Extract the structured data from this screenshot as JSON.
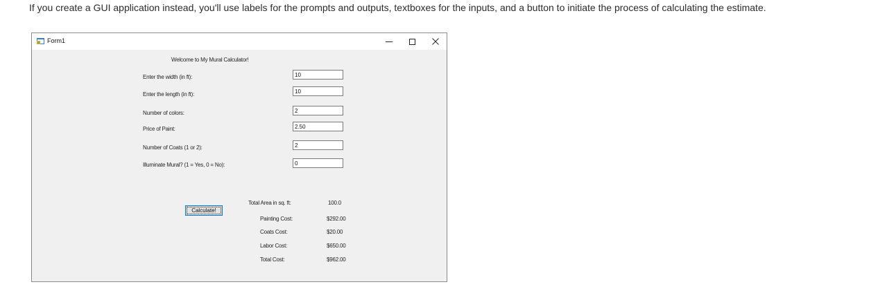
{
  "intro_text": "If you create a GUI application instead, you'll use labels for the prompts and outputs, textboxes for the inputs, and a button to initiate the process of calculating the estimate.",
  "window": {
    "title": "Form1",
    "minimize_glyph": "—",
    "maximize_glyph": "☐",
    "close_glyph": "✕",
    "icon": "winforms-app-icon"
  },
  "form": {
    "welcome": "Welcome to My Mural Calculator!",
    "inputs": [
      {
        "label": "Enter the width (in ft):",
        "value": "10"
      },
      {
        "label": "Enter the length (in ft):",
        "value": "10"
      },
      {
        "label": "Number of colors:",
        "value": "2"
      },
      {
        "label": "Price of Paint:",
        "value": "2.50"
      },
      {
        "label": "Number of Coats (1 or 2):",
        "value": "2"
      },
      {
        "label": "Illuminate Mural? (1 = Yes, 0 = No):",
        "value": "0"
      }
    ],
    "calculate_label": "Calculate!",
    "outputs": [
      {
        "label": "Total Area in sq. ft:",
        "value": "100.0"
      },
      {
        "label": "Painting Cost:",
        "value": "$292.00"
      },
      {
        "label": "Coats Cost:",
        "value": "$20.00"
      },
      {
        "label": "Labor Cost:",
        "value": "$650.00"
      },
      {
        "label": "Total Cost:",
        "value": "$962.00"
      }
    ]
  }
}
